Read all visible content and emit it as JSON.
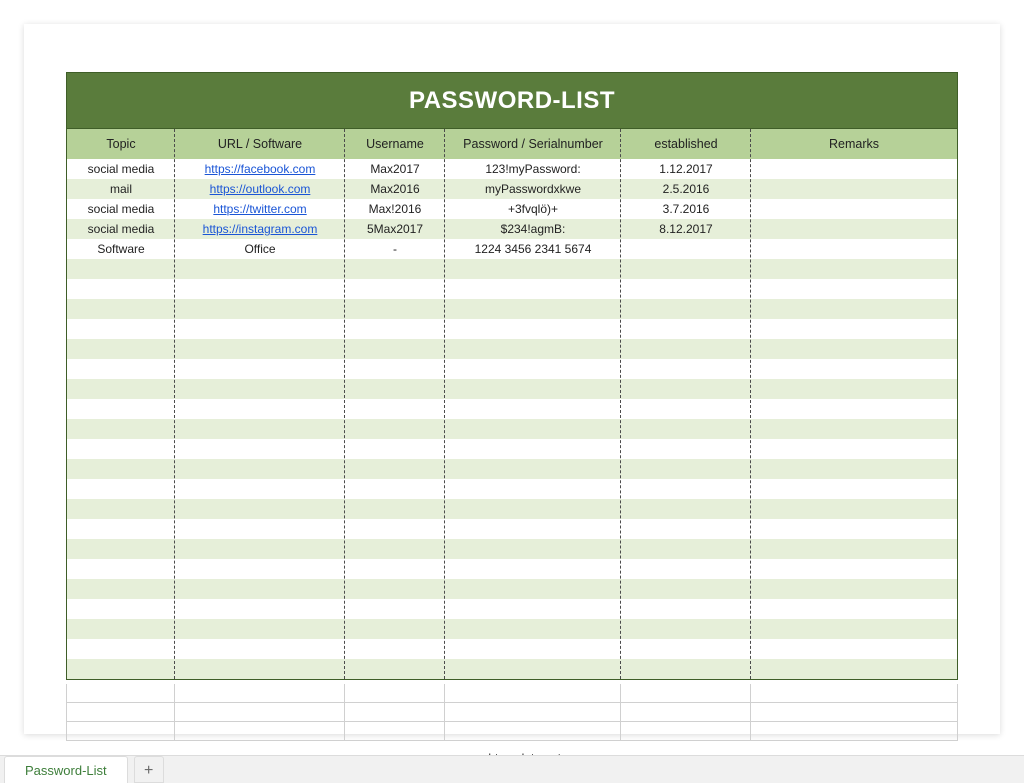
{
  "title": "PASSWORD-LIST",
  "columns": [
    "Topic",
    "URL / Software",
    "Username",
    "Password / Serialnumber",
    "established",
    "Remarks"
  ],
  "rows": [
    {
      "topic": "social media",
      "url": "https://facebook.com",
      "url_is_link": true,
      "user": "Max2017",
      "pwd": "123!myPassword:",
      "date": "1.12.2017",
      "remarks": ""
    },
    {
      "topic": "mail",
      "url": "https://outlook.com",
      "url_is_link": true,
      "user": "Max2016",
      "pwd": "myPasswordxkwe",
      "date": "2.5.2016",
      "remarks": ""
    },
    {
      "topic": "social media",
      "url": "https://twitter.com",
      "url_is_link": true,
      "user": "Max!2016",
      "pwd": "+3fvqlö)+",
      "date": "3.7.2016",
      "remarks": ""
    },
    {
      "topic": "social media",
      "url": "https://instagram.com",
      "url_is_link": true,
      "user": "5Max2017",
      "pwd": "$234!agmB:",
      "date": "8.12.2017",
      "remarks": ""
    },
    {
      "topic": "Software",
      "url": "Office",
      "url_is_link": false,
      "user": "-",
      "pwd": "1224 3456 2341 5674",
      "date": "",
      "remarks": ""
    }
  ],
  "empty_rows": 21,
  "secondary_rows": 3,
  "footer": "excel-template.net",
  "sheet_tab": "Password-List",
  "add_tab_glyph": "+"
}
